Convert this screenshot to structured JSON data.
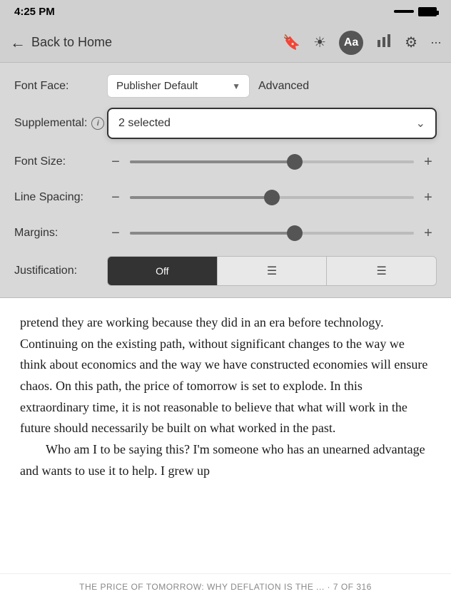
{
  "status": {
    "time": "4:25 PM"
  },
  "nav": {
    "back_label": "Back to Home",
    "icons": {
      "bookmark": "🔖",
      "brightness": "☀",
      "font": "Aa",
      "chart": "📊",
      "settings": "⚙",
      "more": "•••"
    }
  },
  "settings": {
    "font_face_label": "Font Face:",
    "font_face_value": "Publisher Default",
    "advanced_label": "Advanced",
    "supplemental_label": "Supplemental:",
    "supplemental_value": "2 selected",
    "font_size_label": "Font Size:",
    "line_spacing_label": "Line Spacing:",
    "margins_label": "Margins:",
    "justification_label": "Justification:",
    "justification_options": [
      "Off",
      "≡",
      "≡"
    ],
    "justification_active": 0,
    "font_size_pct": 58,
    "line_spacing_pct": 50,
    "margins_pct": 58
  },
  "book": {
    "text1": "pretend they are working because they did in an era before technology. Continuing on the existing path, without significant changes to the way we think about economics and the way we have constructed economies will ensure chaos. On this path, the price of tomorrow is set to explode. In this extraordinary time, it is not reasonable to believe that what will work in the future should necessarily be built on what worked in the past.",
    "text2": "Who am I to be saying this? I'm someone who has an unearned advantage and wants to use it to help. I grew up",
    "footer": "THE PRICE OF TOMORROW: WHY DEFLATION IS THE ... · 7 OF 316"
  }
}
